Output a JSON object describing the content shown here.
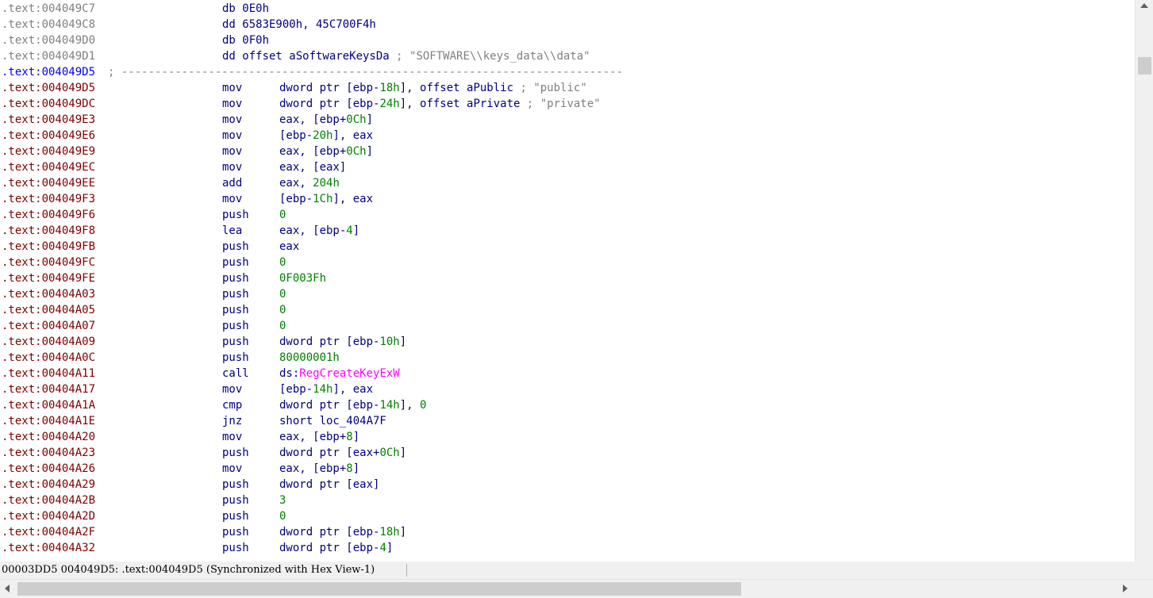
{
  "listing": {
    "header": [
      {
        "addr": ".text:004049C7",
        "text": "db 0E0h"
      },
      {
        "addr": ".text:004049C8",
        "text": "dd 6583E900h, 45C700F4h"
      },
      {
        "addr": ".text:004049D0",
        "text": "db 0F0h"
      },
      {
        "addr": ".text:004049D1",
        "text": "dd offset aSoftwareKeysDa",
        "comment": "; \"SOFTWARE\\\\keys_data\\\\data\""
      }
    ],
    "separator": {
      "addr": ".text:004049D5",
      "text": "; ---------------------------------------------------------------------------"
    },
    "rows": [
      {
        "addr": ".text:004049D5",
        "mnem": "mov",
        "op1": "dword ptr [ebp-",
        "num": "18h",
        "op2": "], offset aPublic",
        "comment": " ; \"public\""
      },
      {
        "addr": ".text:004049DC",
        "mnem": "mov",
        "op1": "dword ptr [ebp-",
        "num": "24h",
        "op2": "], offset aPrivate",
        "comment": " ; \"private\""
      },
      {
        "addr": ".text:004049E3",
        "mnem": "mov",
        "op1": "eax, [ebp+",
        "num": "0Ch",
        "op2": "]"
      },
      {
        "addr": ".text:004049E6",
        "mnem": "mov",
        "op1": "[ebp-",
        "num": "20h",
        "op2": "], eax"
      },
      {
        "addr": ".text:004049E9",
        "mnem": "mov",
        "op1": "eax, [ebp+",
        "num": "0Ch",
        "op2": "]"
      },
      {
        "addr": ".text:004049EC",
        "mnem": "mov",
        "op1": "eax, [eax]",
        "num": "",
        "op2": ""
      },
      {
        "addr": ".text:004049EE",
        "mnem": "add",
        "op1": "eax, ",
        "num": "204h",
        "op2": ""
      },
      {
        "addr": ".text:004049F3",
        "mnem": "mov",
        "op1": "[ebp-",
        "num": "1Ch",
        "op2": "], eax"
      },
      {
        "addr": ".text:004049F6",
        "mnem": "push",
        "op1": "",
        "num": "0",
        "op2": ""
      },
      {
        "addr": ".text:004049F8",
        "mnem": "lea",
        "op1": "eax, [ebp-",
        "num": "4",
        "op2": "]"
      },
      {
        "addr": ".text:004049FB",
        "mnem": "push",
        "op1": "eax",
        "num": "",
        "op2": ""
      },
      {
        "addr": ".text:004049FC",
        "mnem": "push",
        "op1": "",
        "num": "0",
        "op2": ""
      },
      {
        "addr": ".text:004049FE",
        "mnem": "push",
        "op1": "",
        "num": "0F003Fh",
        "op2": ""
      },
      {
        "addr": ".text:00404A03",
        "mnem": "push",
        "op1": "",
        "num": "0",
        "op2": ""
      },
      {
        "addr": ".text:00404A05",
        "mnem": "push",
        "op1": "",
        "num": "0",
        "op2": ""
      },
      {
        "addr": ".text:00404A07",
        "mnem": "push",
        "op1": "",
        "num": "0",
        "op2": ""
      },
      {
        "addr": ".text:00404A09",
        "mnem": "push",
        "op1": "dword ptr [ebp-",
        "num": "10h",
        "op2": "]"
      },
      {
        "addr": ".text:00404A0C",
        "mnem": "push",
        "op1": "",
        "num": "80000001h",
        "op2": ""
      },
      {
        "addr": ".text:00404A11",
        "mnem": "call",
        "op1": "ds:",
        "imp": "RegCreateKeyExW",
        "num": "",
        "op2": ""
      },
      {
        "addr": ".text:00404A17",
        "mnem": "mov",
        "op1": "[ebp-",
        "num": "14h",
        "op2": "], eax"
      },
      {
        "addr": ".text:00404A1A",
        "mnem": "cmp",
        "op1": "dword ptr [ebp-",
        "num": "14h",
        "op2": "], ",
        "num2": "0"
      },
      {
        "addr": ".text:00404A1E",
        "mnem": "jnz",
        "op1": "short loc_404A7F",
        "num": "",
        "op2": ""
      },
      {
        "addr": ".text:00404A20",
        "mnem": "mov",
        "op1": "eax, [ebp+",
        "num": "8",
        "op2": "]"
      },
      {
        "addr": ".text:00404A23",
        "mnem": "push",
        "op1": "dword ptr [eax+",
        "num": "0Ch",
        "op2": "]"
      },
      {
        "addr": ".text:00404A26",
        "mnem": "mov",
        "op1": "eax, [ebp+",
        "num": "8",
        "op2": "]"
      },
      {
        "addr": ".text:00404A29",
        "mnem": "push",
        "op1": "dword ptr [eax]",
        "num": "",
        "op2": ""
      },
      {
        "addr": ".text:00404A2B",
        "mnem": "push",
        "op1": "",
        "num": "3",
        "op2": ""
      },
      {
        "addr": ".text:00404A2D",
        "mnem": "push",
        "op1": "",
        "num": "0",
        "op2": ""
      },
      {
        "addr": ".text:00404A2F",
        "mnem": "push",
        "op1": "dword ptr [ebp-",
        "num": "18h",
        "op2": "]"
      },
      {
        "addr": ".text:00404A32",
        "mnem": "push",
        "op1": "dword ptr [ebp-",
        "num": "4",
        "op2": "]"
      }
    ]
  },
  "statusbar": {
    "text": "00003DD5 004049D5: .text:004049D5 (Synchronized with Hex View-1)"
  },
  "colors": {
    "address": "#7f0000",
    "address_inactive": "#808080",
    "address_selected": "#0000ff",
    "mnemonic": "#000080",
    "number": "#008000",
    "comment": "#808080",
    "import": "#ff00ff"
  }
}
